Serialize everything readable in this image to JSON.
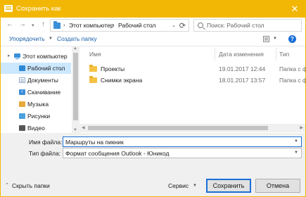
{
  "window": {
    "title": "Сохранить как",
    "accent_color": "#f2b705",
    "close_symbol": "✕"
  },
  "nav": {
    "back_symbol": "←",
    "forward_symbol": "→",
    "recent_symbol": "▾",
    "up_symbol": "↑",
    "address": [
      "Этот компьютер",
      "Рабочий стол"
    ],
    "address_separator": "›",
    "address_dropdown_symbol": "⌄",
    "refresh_symbol": "⟳",
    "search_placeholder": "Поиск: Рабочий стол"
  },
  "toolbar": {
    "organize_label": "Упорядочить",
    "organize_caret": "▼",
    "new_folder_label": "Создать папку",
    "view_caret": "▼",
    "help_symbol": "?"
  },
  "tree": {
    "expand_symbol": "▸",
    "items": [
      {
        "label": "Этот компьютер",
        "icon": "computer-icon"
      },
      {
        "label": "Рабочий стол",
        "icon": "desktop-icon",
        "selected": true
      },
      {
        "label": "Документы",
        "icon": "documents-icon"
      },
      {
        "label": "Скачивание",
        "icon": "downloads-icon"
      },
      {
        "label": "Музыка",
        "icon": "music-icon"
      },
      {
        "label": "Рисунки",
        "icon": "pictures-icon"
      },
      {
        "label": "Видео",
        "icon": "video-icon"
      }
    ]
  },
  "files": {
    "columns": {
      "name": "Имя",
      "date": "Дата изменения",
      "type": "Тип"
    },
    "rows": [
      {
        "name": "Проекты",
        "date": "19.01.2017 12:44",
        "type": "Папка с ф"
      },
      {
        "name": "Снимки экрана",
        "date": "18.01.2017 13:57",
        "type": "Папка с ф"
      }
    ]
  },
  "scroll": {
    "up_symbol": "▲",
    "down_symbol": "▼",
    "left_symbol": "◀",
    "right_symbol": "▶"
  },
  "form": {
    "filename_label": "Имя файла:",
    "filename_value": "Маршруты на пикник",
    "filetype_label": "Тип файла:",
    "filetype_value": "Формат сообщения Outlook - Юникод",
    "dropdown_caret": "▼"
  },
  "footer": {
    "hide_caret": "⌃",
    "hide_folders_label": "Скрыть папки",
    "tools_label": "Сервис",
    "tools_caret": "▼",
    "save_label": "Сохранить",
    "cancel_label": "Отмена"
  }
}
